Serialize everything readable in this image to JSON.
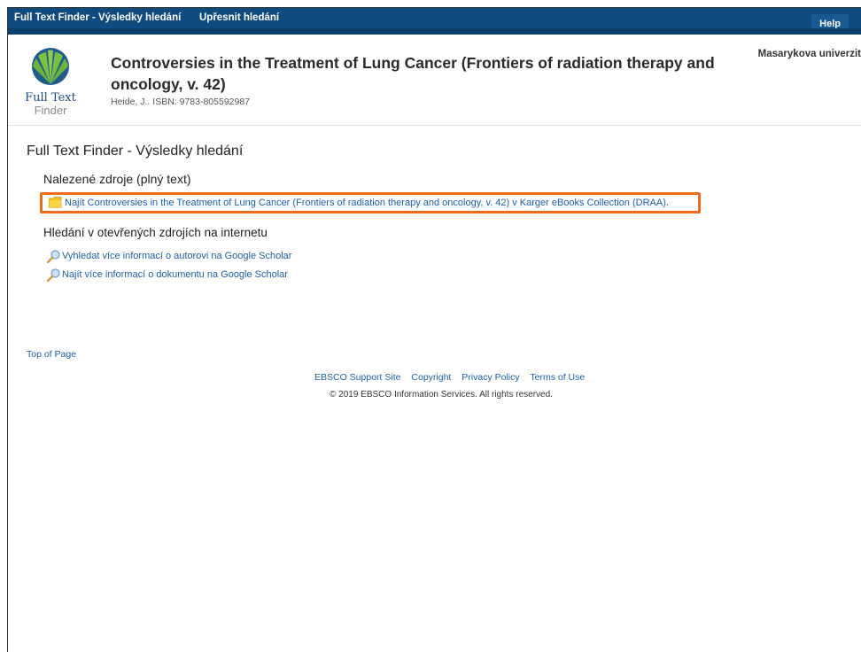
{
  "topbar": {
    "tab_results": "Full Text Finder - Výsledky hledání",
    "tab_refine": "Upřesnit hledání",
    "help": "Help"
  },
  "header": {
    "logo_line1": "Full Text",
    "logo_line2": "Finder",
    "title": "Controversies in the Treatment of Lung Cancer (Frontiers of radiation therapy and oncology, v. 42)",
    "meta": "Heide, J.. ISBN: 9783-805592987",
    "institution": "Masarykova univerzit"
  },
  "main": {
    "heading": "Full Text Finder - Výsledky hledání",
    "found_heading": "Nalezené zdroje (plný text)",
    "result_link": "Najít Controversies in the Treatment of Lung Cancer (Frontiers of radiation therapy and oncology, v. 42) v Karger eBooks Collection (DRAA).",
    "open_heading": "Hledání v otevřených zdrojích na internetu",
    "scholar_author": "Vyhledat více informací o autorovi na Google Scholar",
    "scholar_doc": "Najít více informací o dokumentu na Google Scholar"
  },
  "footer": {
    "top_of_page": "Top of Page",
    "links": [
      "EBSCO Support Site",
      "Copyright",
      "Privacy Policy",
      "Terms of Use"
    ],
    "copyright": "© 2019 EBSCO Information Services. All rights reserved."
  },
  "colors": {
    "nav": "#0f4b7e",
    "link": "#1d5fa8",
    "highlight": "#ee6b18"
  },
  "icons": [
    "full-text-finder-logo",
    "folder-icon",
    "magnifier-icon"
  ]
}
